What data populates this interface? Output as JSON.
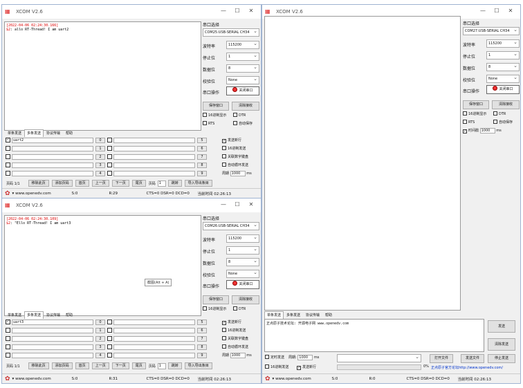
{
  "brand_color": "#d22",
  "w1": {
    "title": "XCOM V2.6",
    "rx": {
      "timestamp": "[2022-04-06 02:24:30.166]",
      "prefix": "$2",
      "text": ": allo RT-Thread! I am uart2"
    },
    "side": {
      "section": "串口选择",
      "port": "COM25:USB-SERIAL CH34",
      "baud_label": "波特率",
      "baud": "115200",
      "stop_label": "停止位",
      "stop": "1",
      "data_label": "数据位",
      "data": "8",
      "parity_label": "校验位",
      "parity": "None",
      "op_label": "串口操作",
      "close_btn": "关闭串口",
      "save_btn": "保存窗口",
      "clear_btn": "清除接收",
      "hex_show": "16进制显示",
      "dtr": "DTR",
      "rts": "RTS",
      "autosave": "自动保存"
    },
    "tabs": [
      "单条发送",
      "多条发送",
      "协议传输",
      "帮助"
    ],
    "rows": [
      {
        "text": "uart2",
        "num": "0",
        "num2": "5"
      },
      {
        "text": "",
        "num": "1",
        "num2": "6"
      },
      {
        "text": "",
        "num": "2",
        "num2": "7"
      },
      {
        "text": "",
        "num": "3",
        "num2": "8"
      },
      {
        "text": "",
        "num": "4",
        "num2": "9"
      }
    ],
    "opts": {
      "newline": "发送新行",
      "hexsend": "16进制发送",
      "bindkb": "关联数字键盘",
      "loop": "自动循环发送",
      "period_label": "周期",
      "period": "1000",
      "ms": "ms"
    },
    "pager": {
      "page": "页码 1/1",
      "remove": "移除此页",
      "add": "添加页码",
      "first": "首页",
      "prev": "上一页",
      "next": "下一页",
      "last": "尾页",
      "page_label": "页码",
      "page_input": "1",
      "jump": "跳转",
      "export": "导入导出条目"
    },
    "status": {
      "site": "www.openedv.com",
      "s": "S:0",
      "r": "R:29",
      "cts": "CTS=0 DSR=0 DCD=0",
      "time": "当前时间 02:26:13"
    }
  },
  "w2": {
    "title": "XCOM V2.6",
    "rx": {
      "timestamp": "[2022-04-06 02:24:30.109]",
      "prefix": "$2",
      "text": ": \"Ello RT-Thread! I am uart3"
    },
    "side": {
      "section": "串口选择",
      "port": "COM26:USB-SERIAL CH34",
      "baud_label": "波特率",
      "baud": "115200",
      "stop_label": "停止位",
      "stop": "1",
      "data_label": "数据位",
      "data": "8",
      "parity_label": "校验位",
      "parity": "None",
      "op_label": "串口操作",
      "close_btn": "关闭串口",
      "save_btn": "保存窗口",
      "clear_btn": "清除接收",
      "hex_show": "16进制显示",
      "dtr": "DTR"
    },
    "tooltip": "截图(Alt + A)",
    "tabs": [
      "单条发送",
      "多条发送",
      "协议传输",
      "帮助"
    ],
    "rows": [
      {
        "text": "uart3",
        "num": "0",
        "num2": "5"
      },
      {
        "text": "",
        "num": "1",
        "num2": "6"
      },
      {
        "text": "",
        "num": "2",
        "num2": "7"
      },
      {
        "text": "",
        "num": "3",
        "num2": "8"
      },
      {
        "text": "",
        "num": "4",
        "num2": "9"
      }
    ],
    "opts": {
      "newline": "发送新行",
      "hexsend": "16进制发送",
      "bindkb": "关联数字键盘",
      "loop": "自动循环发送",
      "period_label": "周期",
      "period": "1000",
      "ms": "ms"
    },
    "pager": {
      "page": "页码 1/1",
      "remove": "移除此页",
      "add": "添加页码",
      "first": "首页",
      "prev": "上一页",
      "next": "下一页",
      "last": "尾页",
      "page_label": "页码",
      "page_input": "1",
      "jump": "跳转",
      "export": "导入导出条目"
    },
    "status": {
      "site": "www.openedv.com",
      "s": "S:0",
      "r": "R:31",
      "cts": "CTS=0 DSR=0 DCD=0",
      "time": "当前时间 02:26:13"
    }
  },
  "w3": {
    "title": "XCOM V2.6",
    "side": {
      "section": "串口选择",
      "port": "COM27:USB-SERIAL CH34",
      "baud_label": "波特率",
      "baud": "115200",
      "stop_label": "停止位",
      "stop": "1",
      "data_label": "数据位",
      "data": "8",
      "parity_label": "校验位",
      "parity": "None",
      "op_label": "串口操作",
      "close_btn": "关闭串口",
      "save_btn": "保存窗口",
      "clear_btn": "清除接收",
      "hex_show": "16进制显示",
      "dtr": "DTR",
      "rts": "RTS",
      "autosave": "自动保存",
      "timestamp": "时间戳",
      "ts_val": "1000",
      "ms": "ms"
    },
    "tabs": [
      "单条发送",
      "多条发送",
      "协议传输",
      "帮助"
    ],
    "send_text": "正点原子技术论坛: 开源电子网 www.openedv.com",
    "send_btn": "发送",
    "clear_send_btn": "清除发送",
    "timed_send": "定时发送",
    "period_label": "周期:",
    "period": "1000",
    "ms": "ms",
    "open_file": "打开文件",
    "send_file": "发送文件",
    "stop_send": "停止发送",
    "hex_send": "16进制发送",
    "newline": "发送新行",
    "pct": "0%",
    "forum_url": "正点原子官方论坛http://www.openedv.com/",
    "status": {
      "site": "www.openedv.com",
      "s": "S:0",
      "r": "R:0",
      "cts": "CTS=0 DSR=0 DCD=0",
      "time": "当前时间 02:26:13"
    }
  }
}
